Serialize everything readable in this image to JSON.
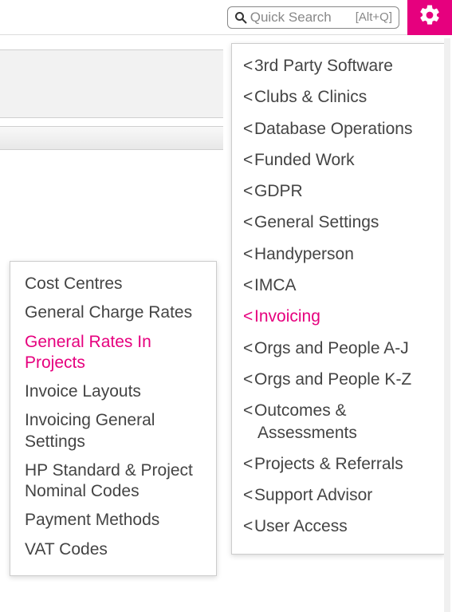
{
  "search": {
    "placeholder": "Quick Search",
    "hint": "[Alt+Q]"
  },
  "mainMenu": {
    "items": [
      {
        "label": "3rd Party Software"
      },
      {
        "label": "Clubs & Clinics"
      },
      {
        "label": "Database Operations"
      },
      {
        "label": "Funded Work"
      },
      {
        "label": "GDPR"
      },
      {
        "label": "General Settings"
      },
      {
        "label": "Handyperson"
      },
      {
        "label": "IMCA"
      },
      {
        "label": "Invoicing",
        "active": true
      },
      {
        "label": "Orgs and People A-J"
      },
      {
        "label": "Orgs and People K-Z"
      },
      {
        "label": "Outcomes &",
        "label2": "Assessments"
      },
      {
        "label": "Projects & Referrals"
      },
      {
        "label": "Support Advisor"
      },
      {
        "label": "User Access"
      }
    ]
  },
  "subMenu": {
    "items": [
      {
        "label": "Cost Centres"
      },
      {
        "label": "General Charge Rates"
      },
      {
        "label": "General Rates In Projects",
        "active": true
      },
      {
        "label": "Invoice Layouts"
      },
      {
        "label": "Invoicing General Settings"
      },
      {
        "label": "HP Standard & Project Nominal Codes"
      },
      {
        "label": "Payment Methods"
      },
      {
        "label": "VAT Codes"
      }
    ]
  }
}
